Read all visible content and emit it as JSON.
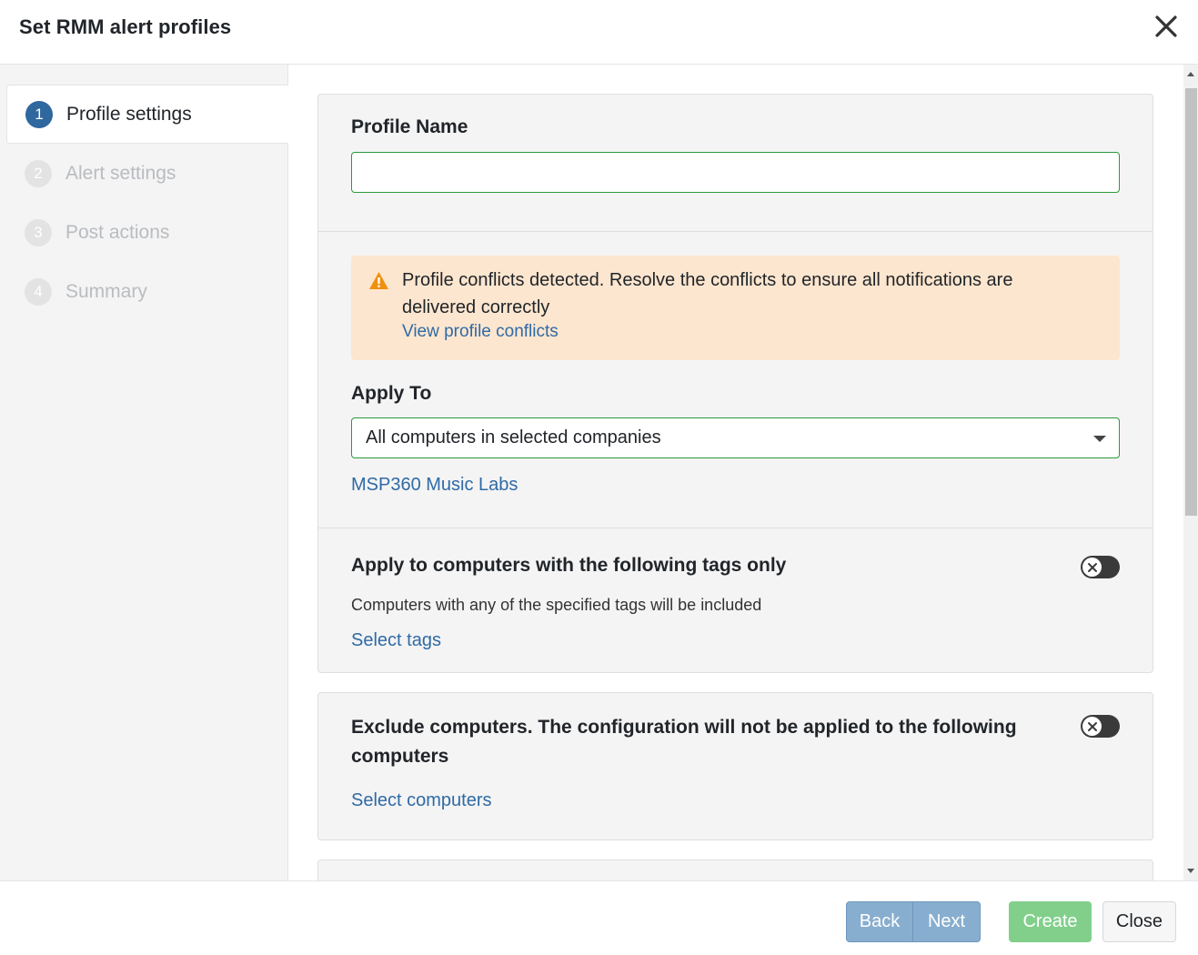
{
  "dialog": {
    "title": "Set RMM alert profiles",
    "close_icon": "close-icon"
  },
  "steps": [
    {
      "num": "1",
      "label": "Profile settings",
      "active": true
    },
    {
      "num": "2",
      "label": "Alert settings",
      "active": false
    },
    {
      "num": "3",
      "label": "Post actions",
      "active": false
    },
    {
      "num": "4",
      "label": "Summary",
      "active": false
    }
  ],
  "profile": {
    "label": "Profile Name",
    "value": "",
    "placeholder": ""
  },
  "alert": {
    "icon": "warning-icon",
    "message": "Profile conflicts detected. Resolve the conflicts to ensure all notifications are delivered correctly",
    "link": "View profile conflicts",
    "bg_color": "#fde6cf"
  },
  "apply_to": {
    "label": "Apply To",
    "selected": "All computers in selected companies",
    "company_link": "MSP360 Music Labs"
  },
  "tags": {
    "title": "Apply to computers with the following tags only",
    "description": "Computers with any of the specified tags will be included",
    "link": "Select tags",
    "enabled": false
  },
  "exclude": {
    "title": "Exclude computers. The configuration will not be applied to the following computers",
    "link": "Select computers",
    "enabled": false
  },
  "footer": {
    "back": "Back",
    "next": "Next",
    "create": "Create",
    "close": "Close"
  },
  "colors": {
    "accent": "#2f679f",
    "link": "#2f6aa6",
    "success": "#82cf8c",
    "input_border": "#2a9a3b"
  }
}
